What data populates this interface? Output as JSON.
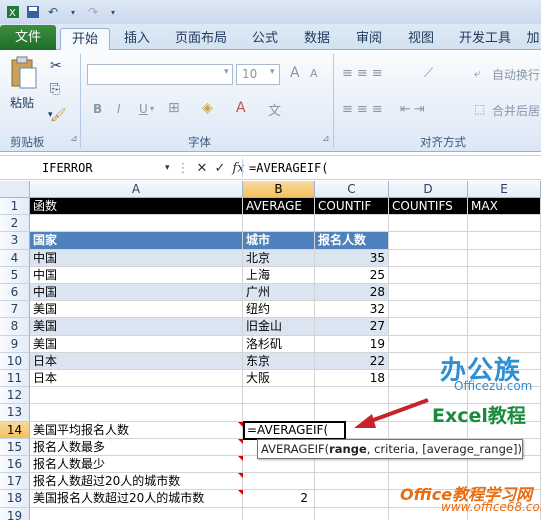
{
  "ribbon": {
    "tabs": [
      "文件",
      "开始",
      "插入",
      "页面布局",
      "公式",
      "数据",
      "审阅",
      "视图",
      "开发工具",
      "加"
    ],
    "active_tab": "开始",
    "paste_label": "粘贴",
    "clipboard_group": "剪贴板",
    "font_group": "字体",
    "align_group": "对齐方式",
    "font_size": "10",
    "wrap_text": "自动换行",
    "merge_center": "合并后居",
    "bold": "B",
    "italic": "I",
    "underline": "U",
    "font_size_up": "A",
    "font_size_down": "A"
  },
  "formula_bar": {
    "name_box": "IFERROR",
    "fx": "fx",
    "formula": "=AVERAGEIF("
  },
  "columns": [
    "A",
    "B",
    "C",
    "D",
    "E"
  ],
  "row_numbers": [
    "1",
    "2",
    "3",
    "4",
    "5",
    "6",
    "7",
    "8",
    "9",
    "10",
    "11",
    "12",
    "13",
    "14",
    "15",
    "16",
    "17",
    "18",
    "19"
  ],
  "row1": [
    "函数",
    "AVERAGE",
    "COUNTIF",
    "COUNTIFS",
    "MAX"
  ],
  "table_header": [
    "国家",
    "城市",
    "报名人数"
  ],
  "table_rows": [
    [
      "中国",
      "北京",
      "35"
    ],
    [
      "中国",
      "上海",
      "25"
    ],
    [
      "中国",
      "广州",
      "28"
    ],
    [
      "美国",
      "纽约",
      "32"
    ],
    [
      "美国",
      "旧金山",
      "27"
    ],
    [
      "美国",
      "洛杉矶",
      "19"
    ],
    [
      "日本",
      "东京",
      "22"
    ],
    [
      "日本",
      "大阪",
      "18"
    ]
  ],
  "questions": [
    "美国平均报名人数",
    "报名人数最多",
    "报名人数最少",
    "报名人数超过20人的城市数",
    "美国报名人数超过20人的城市数"
  ],
  "editing_cell": "=AVERAGEIF(",
  "b18_value": "2",
  "tooltip": {
    "func": "AVERAGEIF(",
    "arg1": "range",
    "rest": ", criteria, [average_range])"
  },
  "watermarks": {
    "logo": "办公族",
    "site": "Officezu.com",
    "tutorial": "Excel教程",
    "office68": "Office教程学习网",
    "office68_url": "www.office68.com"
  },
  "colors": {
    "table_header": "#4f81bd",
    "band": "#dbe5f1",
    "selected_header": "#f1c15f"
  }
}
